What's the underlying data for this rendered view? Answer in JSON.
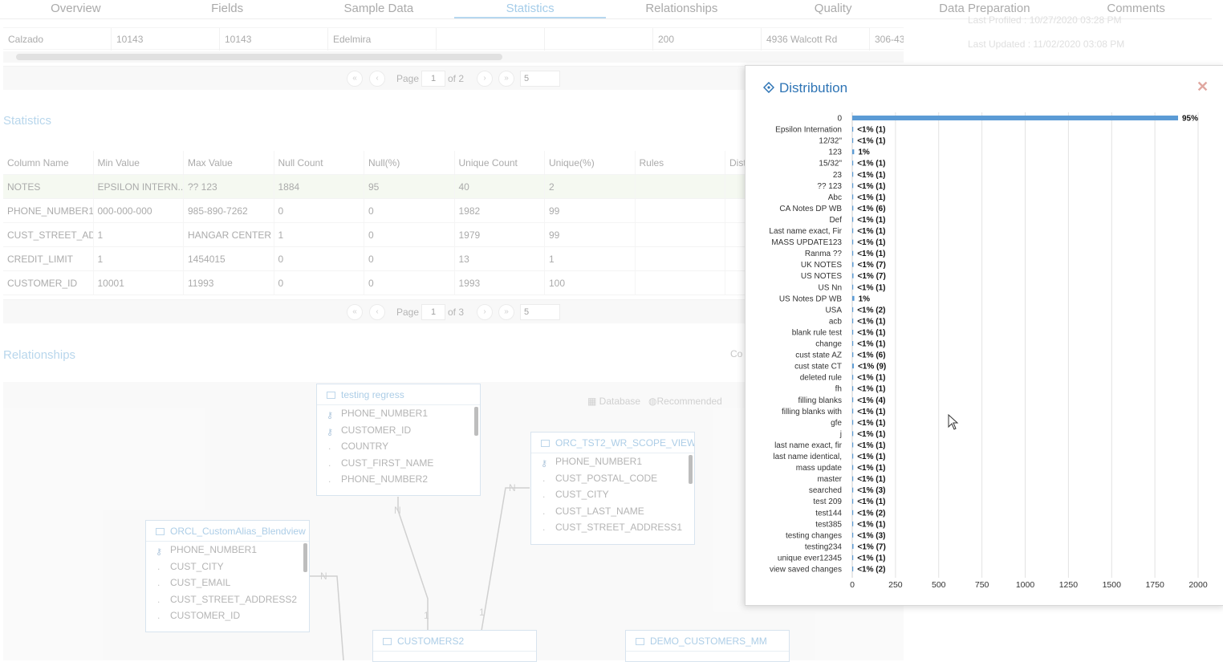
{
  "tabs": [
    "Overview",
    "Fields",
    "Sample Data",
    "Statistics",
    "Relationships",
    "Quality",
    "Data Preparation",
    "Comments"
  ],
  "active_tab": "Statistics",
  "sample_row": [
    "Calzado",
    "10143",
    "10143",
    "Edelmira",
    "",
    "",
    "200",
    "4936 Walcott Rd",
    "306-43"
  ],
  "pager1": {
    "page_label": "Page",
    "page": "1",
    "of": "of 2",
    "size": "5"
  },
  "pager2": {
    "page_label": "Page",
    "page": "1",
    "of": "of 3",
    "size": "5"
  },
  "meta": {
    "last_profiled": "Last Profiled : 10/27/2020 03:28 PM",
    "last_updated": "Last Updated : 11/02/2020 03:08 PM"
  },
  "statistics": {
    "title": "Statistics",
    "headers": [
      "Column Name",
      "Min Value",
      "Max Value",
      "Null Count",
      "Null(%)",
      "Unique Count",
      "Unique(%)",
      "Rules",
      "Dist"
    ],
    "rows": [
      [
        "NOTES",
        "EPSILON INTERN...",
        "?? 123",
        "1884",
        "95",
        "40",
        "2",
        "",
        ""
      ],
      [
        "PHONE_NUMBER1",
        "000-000-000",
        "985-890-7262",
        "0",
        "0",
        "1982",
        "99",
        "",
        ""
      ],
      [
        "CUST_STREET_AD...",
        "1",
        "HANGAR CENTER",
        "1",
        "0",
        "1979",
        "99",
        "",
        ""
      ],
      [
        "CREDIT_LIMIT",
        "1",
        "1454015",
        "0",
        "0",
        "13",
        "1",
        "",
        ""
      ],
      [
        "CUSTOMER_ID",
        "10001",
        "11993",
        "0",
        "0",
        "1993",
        "100",
        "",
        ""
      ]
    ]
  },
  "relationships": {
    "title": "Relationships",
    "con_label": "Co",
    "filters": [
      "Database",
      "Recommended"
    ],
    "entities": [
      {
        "name": "testing regress",
        "fields": [
          "PHONE_NUMBER1",
          "CUSTOMER_ID",
          "COUNTRY",
          "CUST_FIRST_NAME",
          "PHONE_NUMBER2"
        ],
        "keys": [
          true,
          true,
          false,
          false,
          false
        ]
      },
      {
        "name": "ORC_TST2_WR_SCOPE_VIEW",
        "fields": [
          "PHONE_NUMBER1",
          "CUST_POSTAL_CODE",
          "CUST_CITY",
          "CUST_LAST_NAME",
          "CUST_STREET_ADDRESS1"
        ],
        "keys": [
          true,
          false,
          false,
          false,
          false
        ]
      },
      {
        "name": "ORCL_CustomAlias_Blendview",
        "fields": [
          "PHONE_NUMBER1",
          "CUST_CITY",
          "CUST_EMAIL",
          "CUST_STREET_ADDRESS2",
          "CUSTOMER_ID"
        ],
        "keys": [
          true,
          false,
          false,
          false,
          false
        ]
      },
      {
        "name": "CUSTOMERS2",
        "fields": [],
        "keys": []
      },
      {
        "name": "DEMO_CUSTOMERS_MM",
        "fields": [],
        "keys": []
      }
    ],
    "connector_labels": [
      "N",
      "N",
      "N",
      "1",
      "1"
    ]
  },
  "modal": {
    "title": "Distribution",
    "close_icon": "close-icon",
    "accent": "#5b9bd5"
  },
  "chart_data": {
    "type": "bar",
    "orientation": "horizontal",
    "title": "Distribution",
    "categories": [
      "0",
      "Epsilon Internation",
      "12/32\"",
      "123",
      "15/32\"",
      "23",
      "?? 123",
      "Abc",
      "CA Notes DP WB",
      "Def",
      "Last name exact, Fir",
      "MASS UPDATE123",
      "Ranma ??",
      "UK NOTES",
      "US NOTES",
      "US Nn",
      "US Notes DP WB",
      "USA",
      "acb",
      "blank rule test",
      "change",
      "cust state AZ",
      "cust state CT",
      "deleted rule",
      "fh",
      "filling blanks",
      "filling blanks with",
      "gfe",
      "j",
      "last name exact, fir",
      "last name identical,",
      "mass update",
      "master",
      "searched",
      "test 209",
      "test144",
      "test385",
      "testing changes",
      "testing234",
      "unique ever12345",
      "view saved changes"
    ],
    "values": [
      1884,
      1,
      1,
      11,
      1,
      1,
      1,
      1,
      6,
      1,
      1,
      1,
      1,
      7,
      7,
      1,
      12,
      2,
      1,
      1,
      1,
      6,
      9,
      1,
      1,
      4,
      1,
      1,
      1,
      1,
      1,
      1,
      1,
      3,
      1,
      2,
      1,
      3,
      7,
      1,
      2
    ],
    "data_labels": [
      "95%",
      "<1% (1)",
      "<1% (1)",
      "1%",
      "<1% (1)",
      "<1% (1)",
      "<1% (1)",
      "<1% (1)",
      "<1% (6)",
      "<1% (1)",
      "<1% (1)",
      "<1% (1)",
      "<1% (1)",
      "<1% (7)",
      "<1% (7)",
      "<1% (1)",
      "1%",
      "<1% (2)",
      "<1% (1)",
      "<1% (1)",
      "<1% (1)",
      "<1% (6)",
      "<1% (9)",
      "<1% (1)",
      "<1% (1)",
      "<1% (4)",
      "<1% (1)",
      "<1% (1)",
      "<1% (1)",
      "<1% (1)",
      "<1% (1)",
      "<1% (1)",
      "<1% (1)",
      "<1% (3)",
      "<1% (1)",
      "<1% (2)",
      "<1% (1)",
      "<1% (3)",
      "<1% (7)",
      "<1% (1)",
      "<1% (2)"
    ],
    "x_ticks": [
      0,
      250,
      500,
      750,
      1000,
      1250,
      1500,
      1750,
      2000
    ],
    "xlim": [
      0,
      2000
    ],
    "grid": true,
    "bar_color": "#5b9bd5"
  }
}
